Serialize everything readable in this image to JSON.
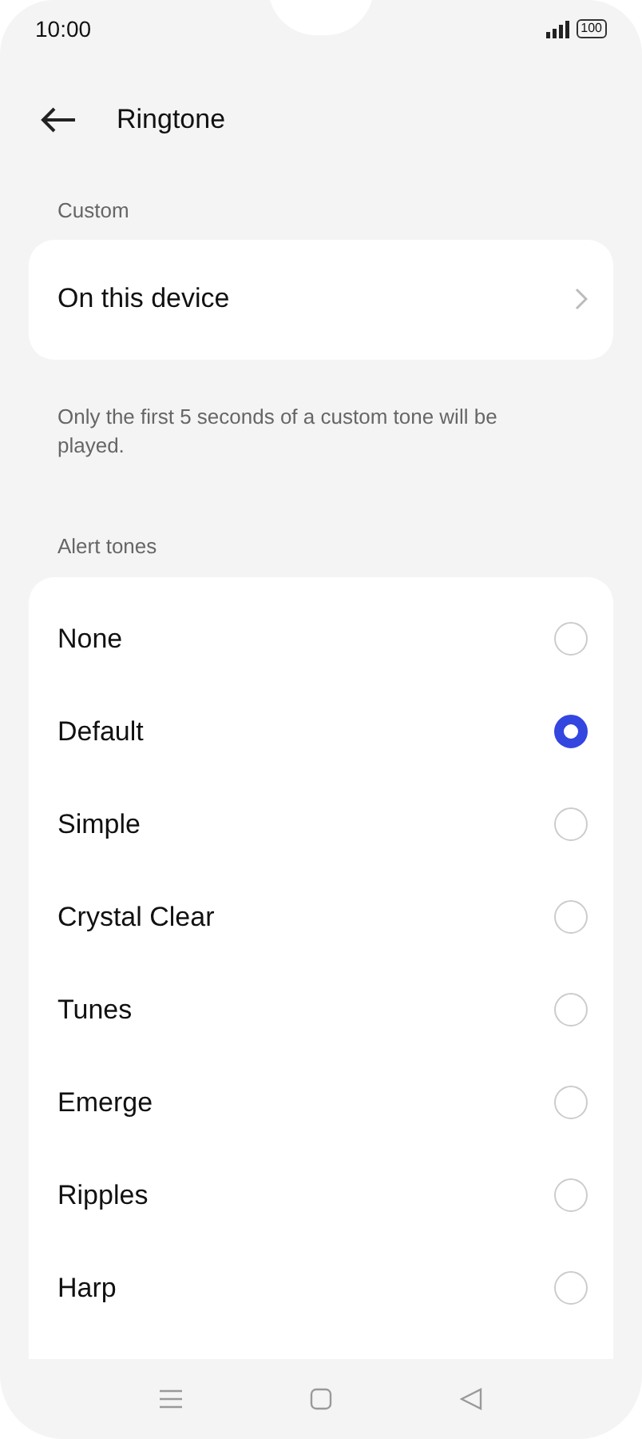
{
  "status_bar": {
    "time": "10:00",
    "battery": "100"
  },
  "header": {
    "title": "Ringtone"
  },
  "custom": {
    "label": "Custom",
    "item": "On this device",
    "note": "Only the first 5 seconds of a custom tone will be played."
  },
  "alert_tones": {
    "label": "Alert tones",
    "items": [
      {
        "label": "None",
        "selected": false
      },
      {
        "label": "Default",
        "selected": true
      },
      {
        "label": "Simple",
        "selected": false
      },
      {
        "label": "Crystal Clear",
        "selected": false
      },
      {
        "label": "Tunes",
        "selected": false
      },
      {
        "label": "Emerge",
        "selected": false
      },
      {
        "label": "Ripples",
        "selected": false
      },
      {
        "label": "Harp",
        "selected": false
      }
    ]
  }
}
